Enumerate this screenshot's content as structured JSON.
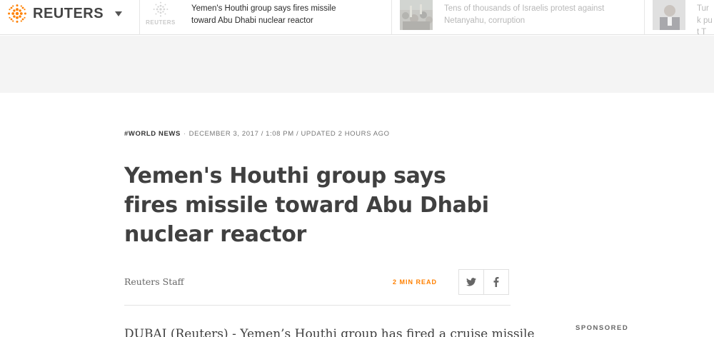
{
  "header": {
    "brand": "REUTERS",
    "brand_menu_icon": "chevron-down-icon",
    "accent_color": "#ff8000",
    "top_stories": [
      {
        "headline": "Yemen's Houthi group says fires missile toward Abu Dhabi nuclear reactor",
        "thumb_brand": "REUTERS",
        "active": true
      },
      {
        "headline": "Tens of thousands of Israelis protest against Netanyahu, corruption",
        "active": false
      },
      {
        "headline": "Turk put T",
        "active": false
      }
    ]
  },
  "article": {
    "channel": "#WORLD NEWS",
    "date": "DECEMBER 3, 2017 / 1:08 PM / UPDATED 2 HOURS AGO",
    "title": "Yemen's Houthi group says fires missile toward Abu Dhabi nuclear reactor",
    "byline": "Reuters Staff",
    "read_time": "2 MIN READ",
    "share_icons": [
      "twitter-icon",
      "facebook-icon"
    ],
    "lead": "DUBAI (Reuters) - Yemen’s Houthi group has fired a cruise missile"
  },
  "sidebar": {
    "sponsored_label": "SPONSORED"
  }
}
